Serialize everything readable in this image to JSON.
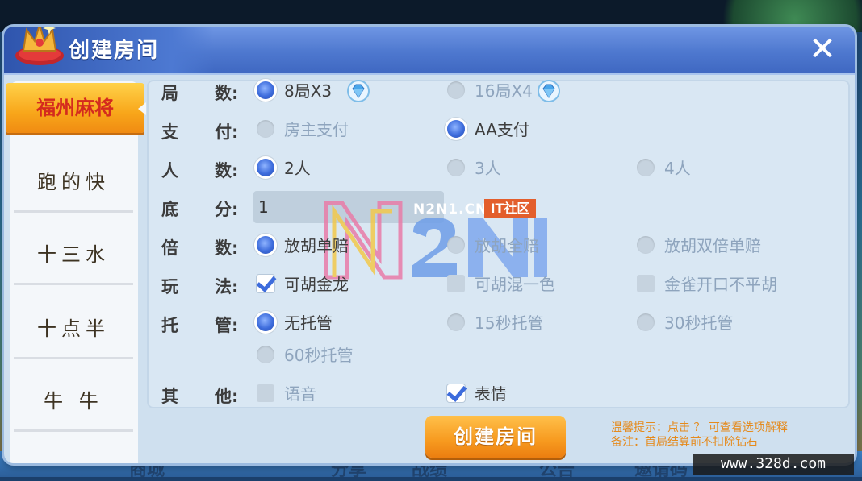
{
  "dialog": {
    "title": "创建房间",
    "close_label": "✕"
  },
  "sidebar": {
    "items": [
      {
        "label": "福州麻将",
        "active": true
      },
      {
        "label": "跑的快"
      },
      {
        "label": "十三水"
      },
      {
        "label": "十点半"
      },
      {
        "label": "牛 牛"
      }
    ]
  },
  "rows": {
    "rounds": {
      "label_a": "局",
      "label_b": "数:",
      "options": [
        "8局X3",
        "16局X4"
      ]
    },
    "payment": {
      "label_a": "支",
      "label_b": "付:",
      "options": [
        "房主支付",
        "AA支付"
      ]
    },
    "players": {
      "label_a": "人",
      "label_b": "数:",
      "options": [
        "2人",
        "3人",
        "4人"
      ]
    },
    "base_score": {
      "label_a": "底",
      "label_b": "分:",
      "value": "1"
    },
    "multiplier": {
      "label_a": "倍",
      "label_b": "数:",
      "options": [
        "放胡单赔",
        "放胡全赔",
        "放胡双倍单赔"
      ]
    },
    "rules": {
      "label_a": "玩",
      "label_b": "法:",
      "options": [
        "可胡金龙",
        "可胡混一色",
        "金雀开口不平胡"
      ]
    },
    "hosting": {
      "label_a": "托",
      "label_b": "管:",
      "options": [
        "无托管",
        "15秒托管",
        "30秒托管",
        "60秒托管"
      ]
    },
    "other": {
      "label_a": "其",
      "label_b": "他:",
      "options": [
        "语音",
        "表情"
      ]
    }
  },
  "create_button": "创建房间",
  "tips": {
    "line1": "温馨提示：点击 ？ 可查看选项解释",
    "line2": "备注：首局结算前不扣除钻石"
  },
  "watermark": {
    "site": "N2N1.CN",
    "badge": "IT社区",
    "url": "www.328d.com"
  },
  "bottom_nav": [
    "商城",
    "分享",
    "战绩",
    "公告",
    "邀请码"
  ],
  "colors": {
    "accent": "#3d6cdc",
    "button": "#f79a1f",
    "active_tab": "#f8a61a",
    "active_tab_text": "#d42a1e"
  }
}
